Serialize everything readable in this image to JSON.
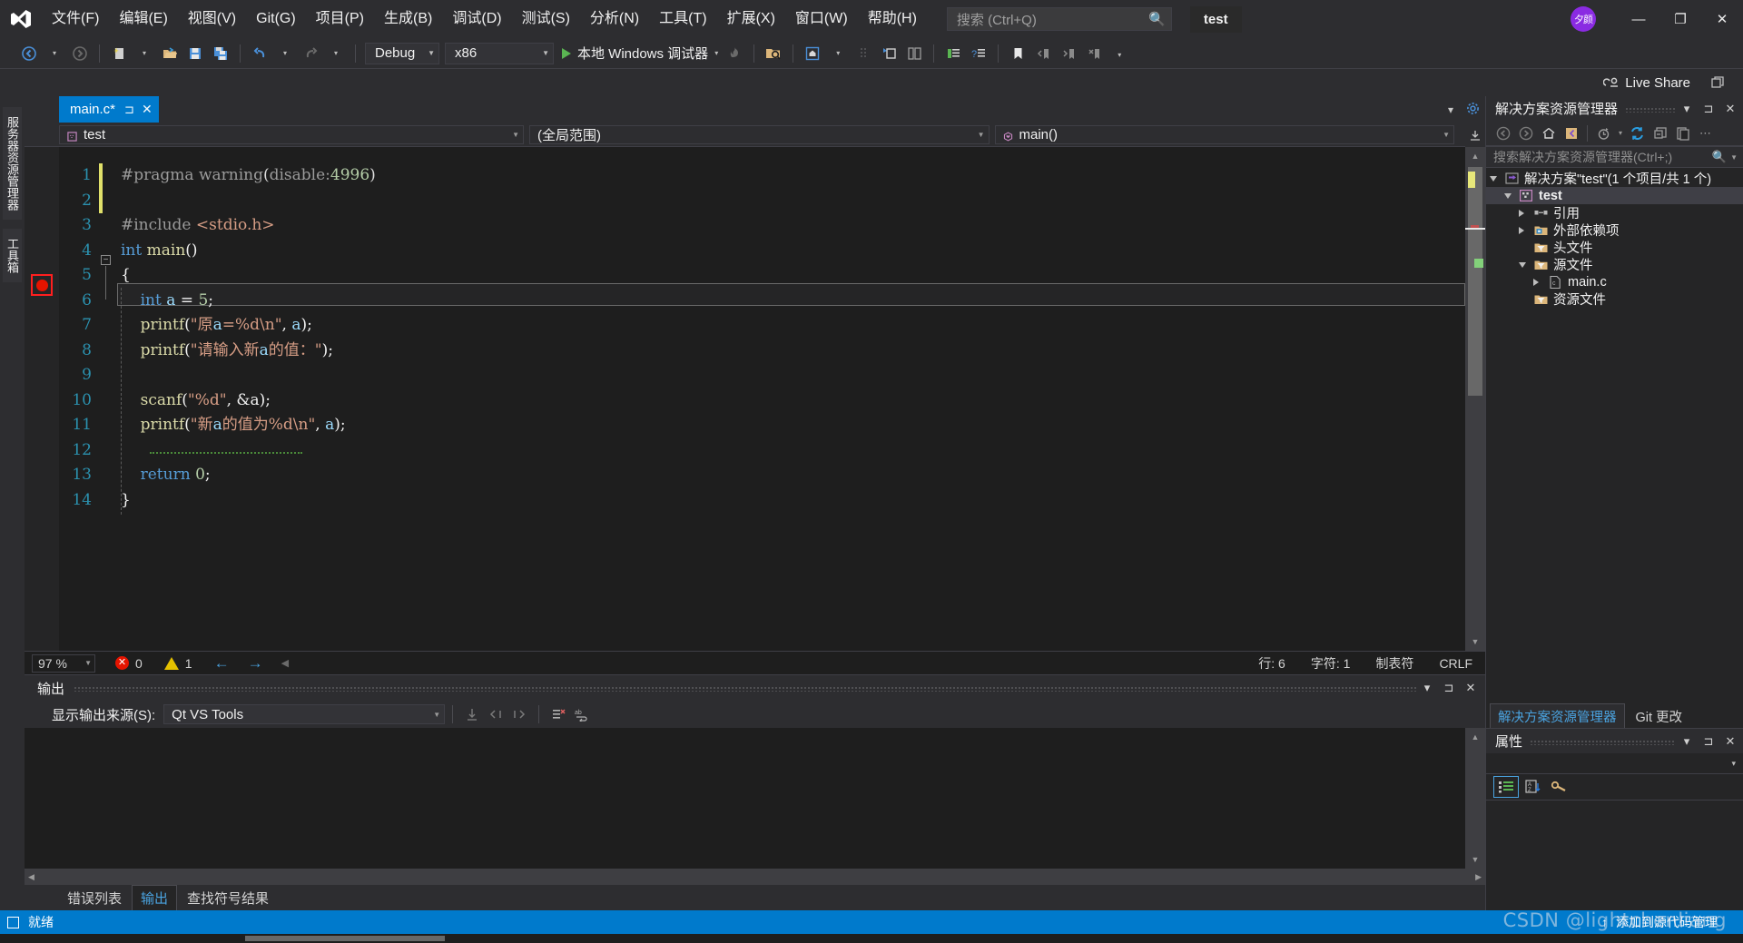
{
  "titlebar": {
    "logo": "vs-logo",
    "menus": [
      "文件(F)",
      "编辑(E)",
      "视图(V)",
      "Git(G)",
      "项目(P)",
      "生成(B)",
      "调试(D)",
      "测试(S)",
      "分析(N)",
      "工具(T)",
      "扩展(X)",
      "窗口(W)",
      "帮助(H)"
    ],
    "search_placeholder": "搜索 (Ctrl+Q)",
    "project_chip": "test",
    "avatar_text": "夕颜",
    "minimize": "—",
    "restore": "❐",
    "close": "✕"
  },
  "toolbar": {
    "back": "◀",
    "forward": "▶",
    "new_item": "new-file",
    "open_file": "open-folder",
    "save": "save",
    "save_all": "save-all",
    "undo": "↶",
    "redo": "↷",
    "config_value": "Debug",
    "platform_value": "x86",
    "run_label": "本地 Windows 调试器",
    "live_share": "Live Share"
  },
  "left_dock": {
    "tabs": [
      "服务器资源管理器",
      "工具箱"
    ]
  },
  "editor": {
    "tab_name": "main.c*",
    "tab_pin": "⊐",
    "tab_close": "✕",
    "nav_project": "test",
    "nav_scope": "(全局范围)",
    "nav_member": "main()",
    "lines": [
      {
        "n": "1",
        "text": "#pragma warning(disable:4996)"
      },
      {
        "n": "2",
        "text": ""
      },
      {
        "n": "3",
        "text": "#include <stdio.h>"
      },
      {
        "n": "4",
        "text": "int main()"
      },
      {
        "n": "5",
        "text": "{"
      },
      {
        "n": "6",
        "text": "    int a = 5;"
      },
      {
        "n": "7",
        "text": "    printf(\"原a=%d\\n\", a);"
      },
      {
        "n": "8",
        "text": "    printf(\"请输入新a的值：\");"
      },
      {
        "n": "9",
        "text": ""
      },
      {
        "n": "10",
        "text": "    scanf(\"%d\", &a);"
      },
      {
        "n": "11",
        "text": "    printf(\"新a的值为%d\\n\", a);"
      },
      {
        "n": "12",
        "text": ""
      },
      {
        "n": "13",
        "text": "    return 0;"
      },
      {
        "n": "14",
        "text": "}"
      }
    ],
    "breakpoint_line": "6",
    "status": {
      "zoom": "97 %",
      "errors": "0",
      "warnings": "1",
      "prev": "←",
      "next": "→",
      "row_label": "行: 6",
      "col_label": "字符: 1",
      "tab_label": "制表符",
      "eol": "CRLF"
    }
  },
  "output": {
    "title": "输出",
    "source_label": "显示输出来源(S):",
    "source_value": "Qt VS Tools",
    "body_text": "",
    "dropdown_icon": "▾",
    "pin_icon": "⊐",
    "close_icon": "✕",
    "tabs": [
      {
        "label": "错误列表",
        "active": false
      },
      {
        "label": "输出",
        "active": true
      },
      {
        "label": "查找符号结果",
        "active": false
      }
    ]
  },
  "solution_explorer": {
    "title": "解决方案资源管理器",
    "dropdown_icon": "▾",
    "pin_icon": "⊐",
    "close_icon": "✕",
    "toolbar_icons": [
      "back-icon",
      "forward-icon",
      "home-icon",
      "show-all-files-icon",
      "pending-changes-icon",
      "refresh-icon",
      "collapse-all-icon",
      "properties-icon",
      "overflow-icon"
    ],
    "search_placeholder": "搜索解决方案资源管理器(Ctrl+;)",
    "tree": [
      {
        "label": "解决方案\"test\"(1 个项目/共 1 个)",
        "indent": 0,
        "twisty": "down",
        "icon": "solution-icon",
        "selected": false,
        "bold": false
      },
      {
        "label": "test",
        "indent": 1,
        "twisty": "down",
        "icon": "cpp-project-icon",
        "selected": true,
        "bold": true
      },
      {
        "label": "引用",
        "indent": 2,
        "twisty": "right",
        "icon": "references-icon",
        "selected": false,
        "bold": false
      },
      {
        "label": "外部依赖项",
        "indent": 2,
        "twisty": "right",
        "icon": "external-deps-icon",
        "selected": false,
        "bold": false
      },
      {
        "label": "头文件",
        "indent": 2,
        "twisty": "none",
        "icon": "filter-folder-icon",
        "selected": false,
        "bold": false
      },
      {
        "label": "源文件",
        "indent": 2,
        "twisty": "down",
        "icon": "filter-folder-icon",
        "selected": false,
        "bold": false
      },
      {
        "label": "main.c",
        "indent": 3,
        "twisty": "right",
        "icon": "c-file-icon",
        "selected": false,
        "bold": false
      },
      {
        "label": "资源文件",
        "indent": 2,
        "twisty": "none",
        "icon": "filter-folder-icon",
        "selected": false,
        "bold": false
      }
    ],
    "dock_tabs": [
      {
        "label": "解决方案资源管理器",
        "active": true
      },
      {
        "label": "Git 更改",
        "active": false
      }
    ]
  },
  "properties": {
    "title": "属性",
    "dropdown_icon": "▾",
    "pin_icon": "⊐",
    "close_icon": "✕",
    "toolbar_icons": [
      "categorized-icon",
      "alphabetical-icon",
      "property-pages-icon"
    ],
    "selector_caret": "▾"
  },
  "statusbar": {
    "ready": "就绪",
    "add_to_source_control": "添加到源代码管理",
    "up_arrow": "↑",
    "watermark": "CSDN @lightchenliang"
  },
  "colors": {
    "accent_blue": "#007acc",
    "titlebar_bg": "#2d2d30",
    "editor_bg": "#1e1e1e",
    "panel_bg": "#252526",
    "breakpoint_red": "#e51400",
    "warning_yellow": "#e5c100",
    "error_red": "#e51400",
    "run_green": "#5ab552"
  }
}
